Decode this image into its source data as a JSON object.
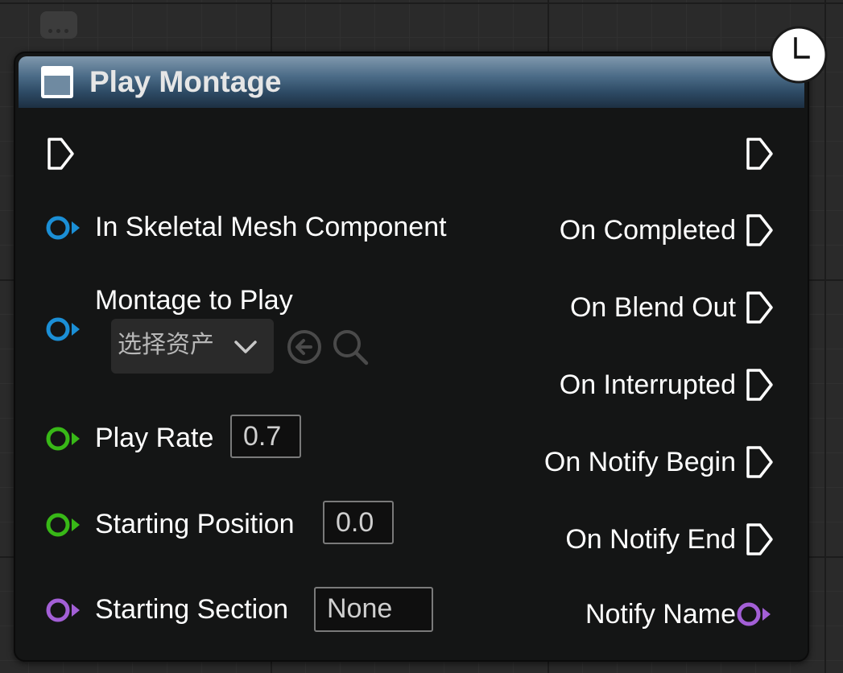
{
  "colors": {
    "exec_pin": "#ffffff",
    "object_pin": "#1b8fd6",
    "float_pin": "#38b817",
    "name_pin": "#a35fd6",
    "header_gradient_top": "#7f98ad",
    "header_gradient_bottom": "#1d2f42",
    "node_body": "#141515"
  },
  "node": {
    "title": "Play Montage",
    "header_icon": "function-node-icon",
    "latent_icon": "clock-icon"
  },
  "inputs": {
    "skeletal_mesh": {
      "label": "In Skeletal Mesh Component",
      "pin_type": "object"
    },
    "montage": {
      "label": "Montage to Play",
      "pin_type": "object",
      "asset_picker_value": "选择资产",
      "browse_icon": "arrow-left-circle-icon",
      "search_icon": "search-icon"
    },
    "play_rate": {
      "label": "Play Rate",
      "value": "0.7",
      "pin_type": "float"
    },
    "starting_position": {
      "label": "Starting Position",
      "value": "0.0",
      "pin_type": "float"
    },
    "starting_section": {
      "label": "Starting Section",
      "value": "None",
      "pin_type": "name"
    }
  },
  "outputs": {
    "on_completed": "On Completed",
    "on_blend_out": "On Blend Out",
    "on_interrupted": "On Interrupted",
    "on_notify_begin": "On Notify Begin",
    "on_notify_end": "On Notify End",
    "notify_name": "Notify Name"
  }
}
